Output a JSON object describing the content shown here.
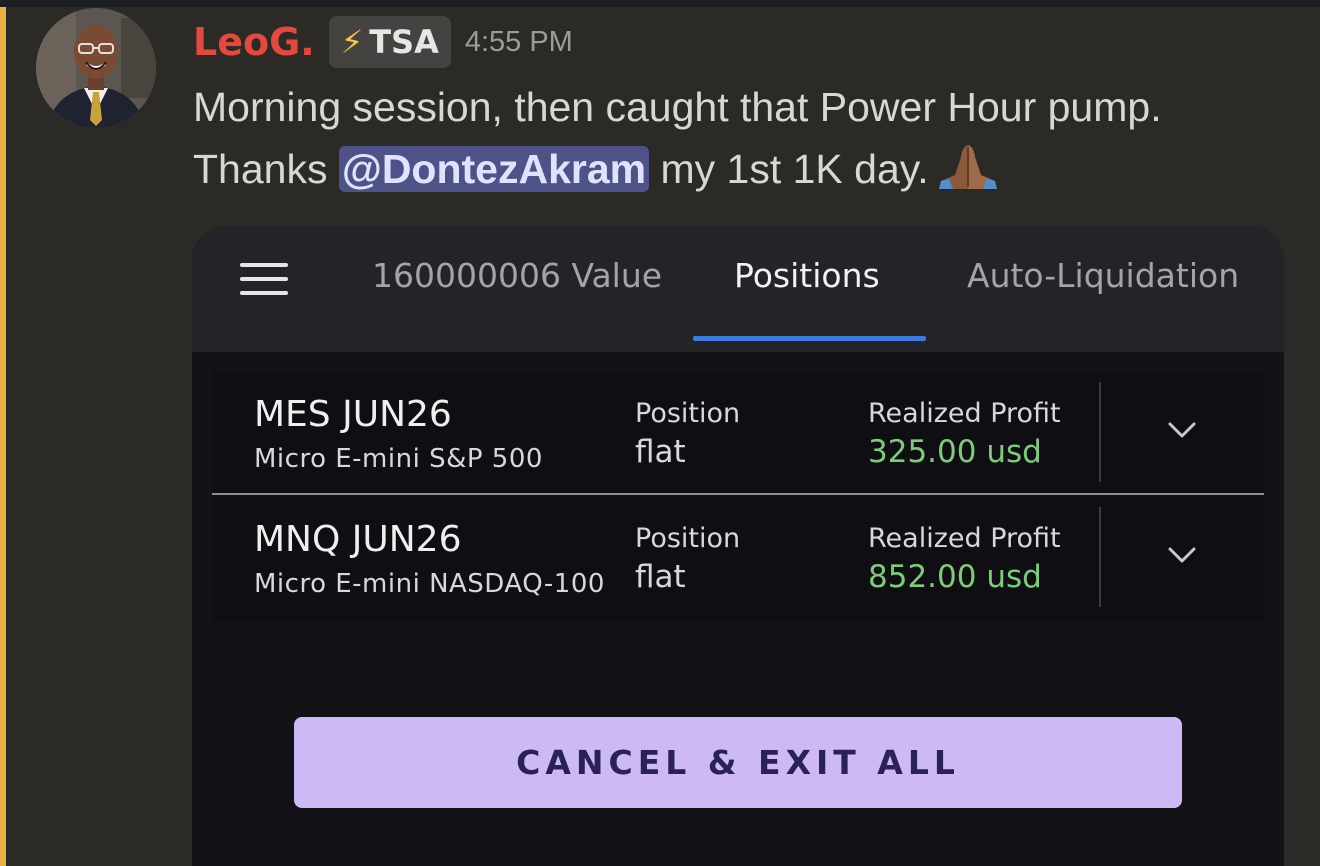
{
  "message": {
    "username": "LeoG.",
    "tag": {
      "icon": "lightning-bolt-icon",
      "label": "TSA"
    },
    "timestamp": "4:55 PM",
    "line1": "Morning session, then caught that Power Hour pump.",
    "line2_before": "Thanks ",
    "mention": "@DontezAkram",
    "line2_after": " my 1st 1K day.",
    "emoji": "folded-hands-emoji",
    "avatar": "user-avatar"
  },
  "card": {
    "tabs": [
      {
        "label": "160000006 Value",
        "active": false
      },
      {
        "label": "Positions",
        "active": true
      },
      {
        "label": "Auto-Liquidation",
        "active": false
      }
    ],
    "positions": [
      {
        "symbol": "MES JUN26",
        "description": "Micro E-mini S&P 500",
        "position_label": "Position",
        "position_value": "flat",
        "profit_label": "Realized Profit",
        "profit_value": "325.00 usd"
      },
      {
        "symbol": "MNQ JUN26",
        "description": "Micro E-mini NASDAQ-100",
        "position_label": "Position",
        "position_value": "flat",
        "profit_label": "Realized Profit",
        "profit_value": "852.00 usd"
      }
    ],
    "exit_button": "CANCEL & EXIT ALL"
  },
  "colors": {
    "username": "#e5493e",
    "profit": "#7ecb7a",
    "tab_active_underline": "#3d7be0",
    "exit_button_bg": "#cdb9f6",
    "mention_bg": "#4d5388",
    "highlight_bar": "#e8b245"
  }
}
